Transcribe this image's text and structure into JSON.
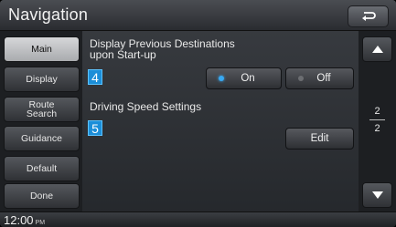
{
  "header": {
    "title": "Navigation",
    "back_icon": "return-arrow-icon"
  },
  "sidebar": {
    "items": [
      {
        "label": "Main",
        "active": true
      },
      {
        "label": "Display",
        "active": false
      },
      {
        "label": "Route\nSearch",
        "active": false
      },
      {
        "label": "Guidance",
        "active": false
      },
      {
        "label": "Default",
        "active": false
      },
      {
        "label": "Done",
        "active": false
      }
    ]
  },
  "settings": {
    "item1": {
      "title": "Display Previous Destinations\nupon Start-up",
      "badge": "4",
      "on_label": "On",
      "off_label": "Off",
      "selected": "On"
    },
    "item2": {
      "title": "Driving Speed Settings",
      "badge": "5",
      "edit_label": "Edit"
    }
  },
  "pager": {
    "current": "2",
    "total": "2",
    "up_icon": "triangle-up-icon",
    "down_icon": "triangle-down-icon"
  },
  "status": {
    "time": "12:00",
    "ampm": "PM"
  },
  "colors": {
    "badge": "#1c8ed8",
    "radio_on": "#38a9f2",
    "active_tab": "#d6d7d9"
  }
}
